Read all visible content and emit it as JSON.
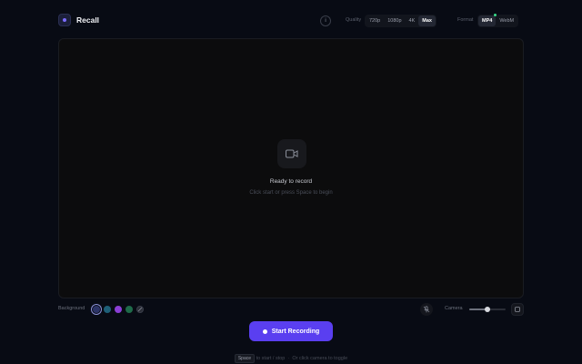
{
  "app": {
    "name": "Recall"
  },
  "header": {
    "info_icon": "info-icon",
    "quality": {
      "label": "Quality",
      "options": [
        "720p",
        "1080p",
        "4K",
        "Max"
      ],
      "selected": "Max"
    },
    "format": {
      "label": "Format",
      "options": [
        "MP4",
        "WebM"
      ],
      "selected": "MP4"
    }
  },
  "preview": {
    "icon": "video-camera-icon",
    "status": "Ready to record",
    "hint": "Click start or press Space to begin"
  },
  "controls": {
    "background_label": "Background",
    "swatches": [
      {
        "name": "navy",
        "color": "#2c3466",
        "selected": true
      },
      {
        "name": "teal",
        "color": "#1e5f78",
        "selected": false
      },
      {
        "name": "purple",
        "color": "#8b3fd6",
        "selected": false
      },
      {
        "name": "green",
        "color": "#1f6b4a",
        "selected": false
      },
      {
        "name": "custom",
        "color": "#2a2d36",
        "selected": false
      }
    ],
    "mic_icon": "microphone-off-icon",
    "camera_label": "Camera",
    "camera_size": 0.5
  },
  "record_button": {
    "label": "Start Recording",
    "color": "#5a3ff0"
  },
  "footer": {
    "key": "Space",
    "text1": "to start / stop",
    "text2": "Or click camera to toggle"
  }
}
